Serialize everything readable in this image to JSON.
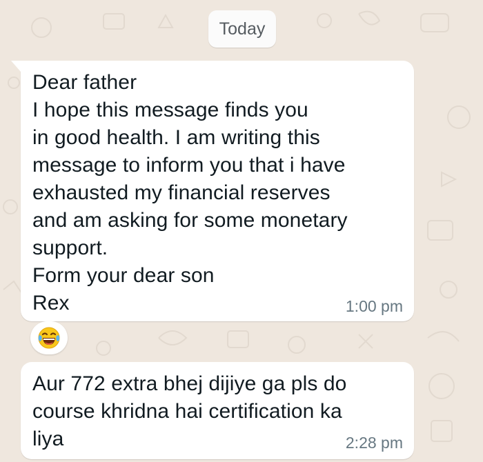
{
  "date_chip": "Today",
  "messages": [
    {
      "lines": [
        "Dear father",
        "I hope this message finds you",
        "in good health. I am writing this",
        "message to inform you that i have",
        "exhausted my financial reserves",
        "and am asking for some monetary",
        "support.",
        "Form your dear son",
        "Rex"
      ],
      "time": "1:00 pm",
      "reaction": "laughing-with-tears-emoji"
    },
    {
      "lines": [
        "Aur 772 extra bhej dijiye ga pls do",
        "course khridna hai certification ka",
        "liya"
      ],
      "time": "2:28 pm"
    }
  ],
  "colors": {
    "wallpaper": "#efe7de",
    "bubble": "#ffffff",
    "timestamp": "#667781",
    "text": "#111b21"
  }
}
